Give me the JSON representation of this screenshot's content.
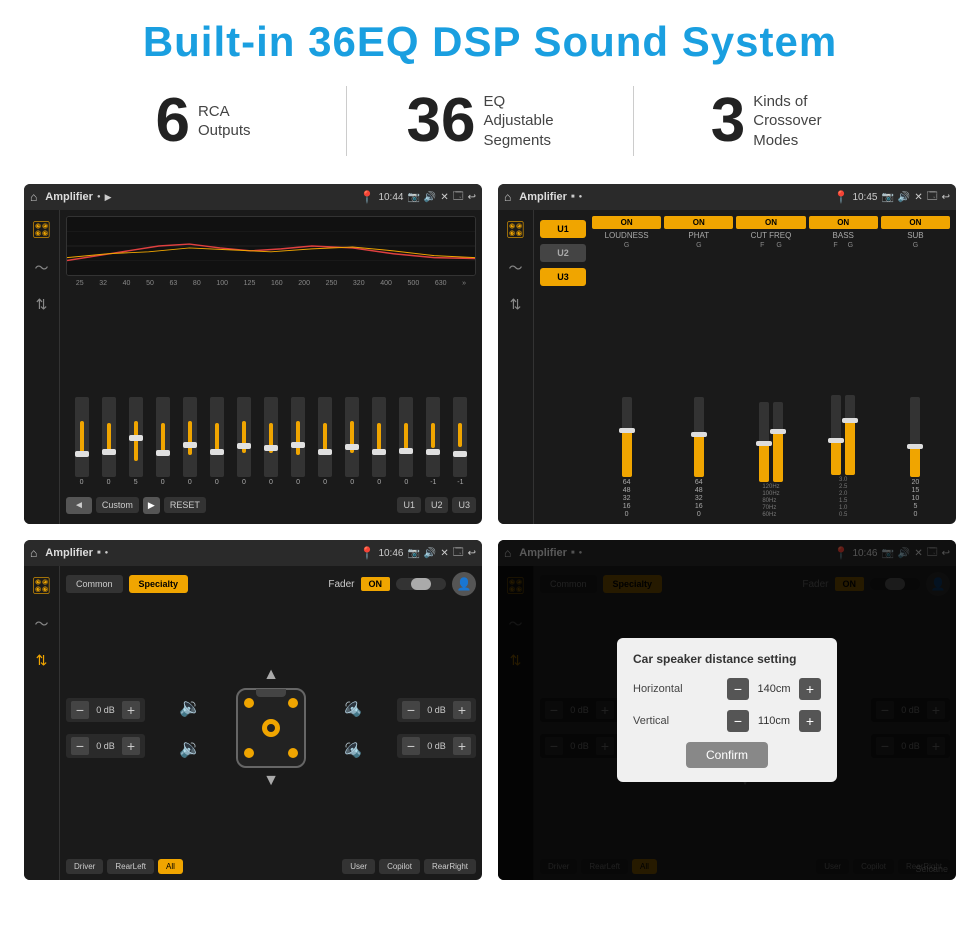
{
  "header": {
    "title": "Built-in 36EQ DSP Sound System"
  },
  "stats": [
    {
      "number": "6",
      "label": "RCA\nOutputs"
    },
    {
      "number": "36",
      "label": "EQ Adjustable\nSegments"
    },
    {
      "number": "3",
      "label": "Kinds of\nCrossover Modes"
    }
  ],
  "screens": {
    "screen1": {
      "topbar": {
        "title": "Amplifier",
        "time": "10:44"
      },
      "eq_freqs": [
        "25",
        "32",
        "40",
        "50",
        "63",
        "80",
        "100",
        "125",
        "160",
        "200",
        "250",
        "320",
        "400",
        "500",
        "630"
      ],
      "bottom_buttons": [
        "Custom",
        "RESET",
        "U1",
        "U2",
        "U3"
      ]
    },
    "screen2": {
      "topbar": {
        "title": "Amplifier",
        "time": "10:45"
      },
      "presets": [
        "U1",
        "U2",
        "U3"
      ],
      "controls": [
        "LOUDNESS",
        "PHAT",
        "CUT FREQ",
        "BASS",
        "SUB"
      ]
    },
    "screen3": {
      "topbar": {
        "title": "Amplifier",
        "time": "10:46"
      },
      "tabs": [
        "Common",
        "Specialty"
      ],
      "fader_label": "Fader",
      "fader_on": "ON",
      "db_values": [
        "0 dB",
        "0 dB",
        "0 dB",
        "0 dB"
      ],
      "zones": [
        "Driver",
        "RearLeft",
        "All",
        "User",
        "Copilot",
        "RearRight"
      ]
    },
    "screen4": {
      "topbar": {
        "title": "Amplifier",
        "time": "10:46"
      },
      "tabs": [
        "Common",
        "Specialty"
      ],
      "dialog": {
        "title": "Car speaker distance setting",
        "horizontal_label": "Horizontal",
        "horizontal_value": "140cm",
        "vertical_label": "Vertical",
        "vertical_value": "110cm",
        "confirm_label": "Confirm"
      },
      "db_values": [
        "0 dB",
        "0 dB"
      ],
      "zones": [
        "Driver",
        "RearLeft",
        "All",
        "User",
        "Copilot",
        "RearRight"
      ]
    }
  },
  "icons": {
    "home": "⌂",
    "settings": "≡",
    "dot": "●",
    "play": "▶",
    "back": "◄",
    "forward": "►",
    "next_track": "»",
    "volume": "🔊",
    "location": "📍",
    "camera": "📷",
    "return": "↩",
    "close": "✕",
    "equalizer": "🎛",
    "waveform": "〜",
    "arrows": "⇅",
    "speaker": "🔉"
  }
}
